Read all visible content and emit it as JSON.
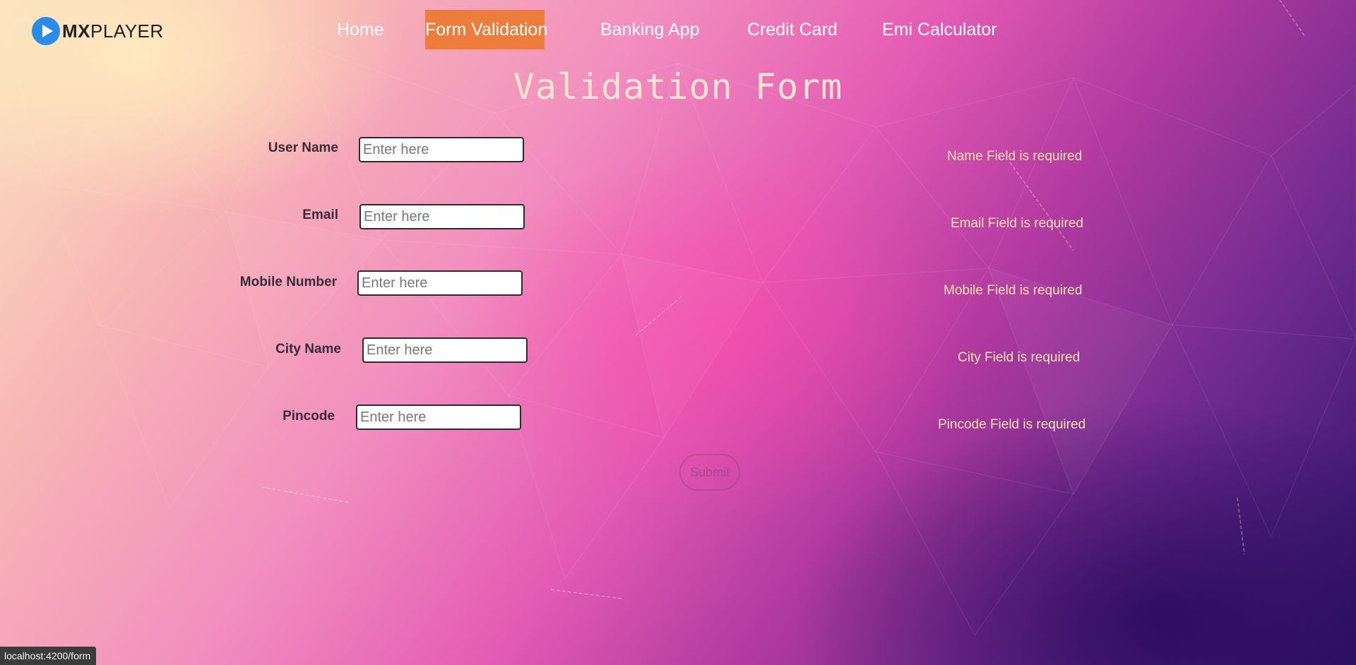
{
  "brand": {
    "logo_text_bold": "MX",
    "logo_text_rest": "PLAYER",
    "icon": "play-circle-icon",
    "icon_color": "#2b8be6"
  },
  "nav": {
    "items": [
      {
        "label": "Home",
        "active": false
      },
      {
        "label": "Form Validation",
        "active": true
      },
      {
        "label": "Banking App",
        "active": false
      },
      {
        "label": "Credit Card",
        "active": false
      },
      {
        "label": "Emi Calculator",
        "active": false
      }
    ],
    "active_color": "#ec7d3d"
  },
  "form": {
    "title": "Validation Form",
    "fields": [
      {
        "label": "User Name",
        "placeholder": "Enter here",
        "value": "",
        "error": "Name Field is required"
      },
      {
        "label": "Email",
        "placeholder": "Enter here",
        "value": "",
        "error": "Email Field is required"
      },
      {
        "label": "Mobile Number",
        "placeholder": "Enter here",
        "value": "",
        "error": "Mobile Field is required"
      },
      {
        "label": "City Name",
        "placeholder": "Enter here",
        "value": "",
        "error": "City Field is required"
      },
      {
        "label": "Pincode",
        "placeholder": "Enter here",
        "value": "",
        "error": "Pincode Field is required"
      }
    ],
    "submit_label": "Submit",
    "error_color": "#f2e3a8"
  },
  "status_bar": {
    "url": "localhost:4200/form"
  }
}
